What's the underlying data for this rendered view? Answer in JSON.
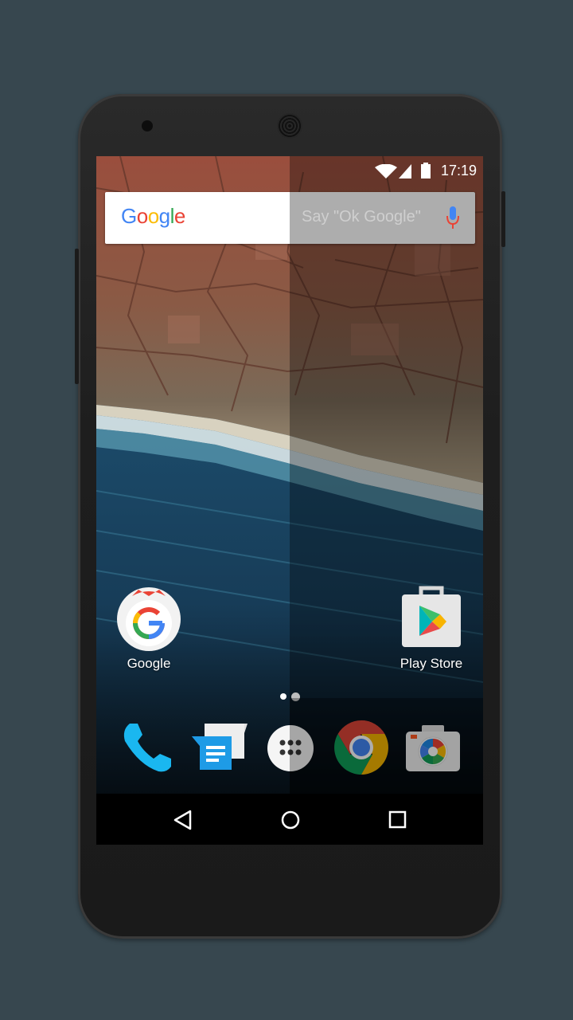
{
  "status_bar": {
    "time": "17:19",
    "icons": [
      "wifi-icon",
      "cell-signal-icon",
      "battery-icon"
    ]
  },
  "search_widget": {
    "logo_text": "Google",
    "placeholder": "Say \"Ok Google\"",
    "mic_icon": "mic-icon"
  },
  "home_apps": [
    {
      "label": "Google",
      "icon": "google-app-icon"
    },
    {
      "label": "Play Store",
      "icon": "play-store-icon"
    }
  ],
  "page_indicator": {
    "pages": 2,
    "current_page": 1
  },
  "dock": [
    {
      "icon": "phone-icon"
    },
    {
      "icon": "messenger-icon"
    },
    {
      "icon": "app-drawer-icon"
    },
    {
      "icon": "chrome-icon"
    },
    {
      "icon": "camera-icon"
    }
  ],
  "nav_bar": {
    "buttons": [
      "back-icon",
      "home-icon",
      "recents-icon"
    ]
  },
  "colors": {
    "background": "#37474f",
    "google_blue": "#4285f4",
    "google_red": "#ea4335",
    "google_yellow": "#fbbc05",
    "google_green": "#34a853",
    "phone_app": "#1ab7f0",
    "messenger_app": "#1e9be6"
  }
}
